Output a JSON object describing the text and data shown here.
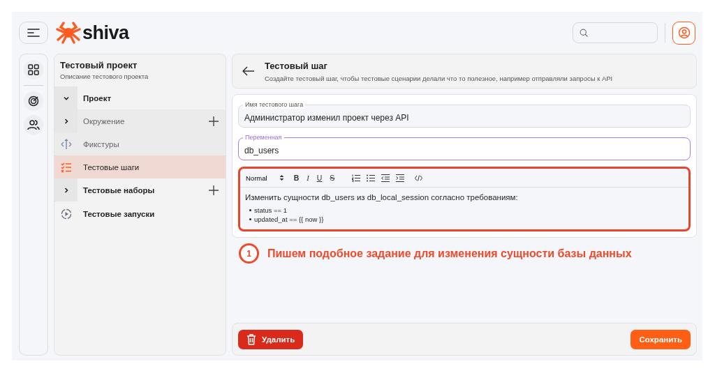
{
  "header": {
    "logo": "shiva"
  },
  "sidebar": {
    "title": "Тестовый проект",
    "subtitle": "Описание тестового проекта",
    "items": [
      {
        "kind": "group",
        "label": "Проект",
        "expanded": true,
        "addable": false,
        "selected": false,
        "children": [
          {
            "kind": "group",
            "label": "Окружение",
            "expanded": false,
            "addable": true,
            "selected": false
          },
          {
            "kind": "fixtures",
            "label": "Фикстуры",
            "selected": false
          },
          {
            "kind": "steps",
            "label": "Тестовые шаги",
            "selected": true
          }
        ]
      },
      {
        "kind": "group",
        "label": "Тестовые наборы",
        "expanded": false,
        "addable": true,
        "selected": false
      },
      {
        "kind": "runs",
        "label": "Тестовые запуски",
        "selected": false
      }
    ]
  },
  "page": {
    "title": "Тестовый шаг",
    "subtitle": "Создайте тестовый шаг, чтобы тестовые сценарии делали что то полезное, например отправляли запросы к API"
  },
  "fields": [
    {
      "label": "Имя тестового шага",
      "value": "Администратор изменил проект через API",
      "focused": false
    },
    {
      "label": "Переменная",
      "value": "db_users",
      "focused": true
    }
  ],
  "editor": {
    "highlighted": true,
    "style": "Normal",
    "marks": [
      "B",
      "I",
      "U",
      "S"
    ],
    "paragraph": "Изменить сущности db_users из db_local_session согласно требованиям:",
    "bullets": [
      "status == 1",
      "updated_at == {{ now }}"
    ]
  },
  "annotation": {
    "number": "1",
    "text": "Пишем подобное задание для изменения сущности базы данных"
  },
  "buttons": {
    "delete": "Удалить",
    "save": "Сохранить"
  }
}
